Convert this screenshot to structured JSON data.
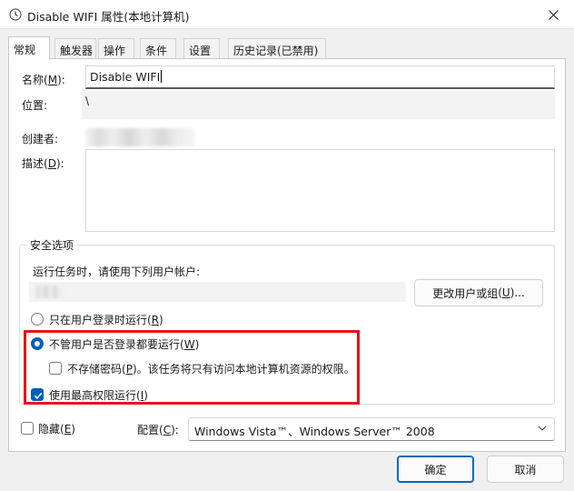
{
  "window": {
    "title": "Disable WIFI 属性(本地计算机)",
    "icon": "clock-icon"
  },
  "tabs": [
    "常规",
    "触发器",
    "操作",
    "条件",
    "设置",
    "历史记录(已禁用)"
  ],
  "general": {
    "name_label": "名称",
    "name_accel": "M",
    "name_value": "Disable WIFI",
    "location_label": "位置:",
    "location_value": "\\",
    "author_label": "创建者:",
    "description_label": "描述",
    "description_accel": "D"
  },
  "security": {
    "group_title": "安全选项",
    "run_as_text": "运行任务时，请使用下列用户帐户:",
    "change_user_label": "更改用户或组",
    "change_user_accel": "U",
    "option_logged_on": "只在用户登录时运行",
    "option_logged_on_accel": "R",
    "option_whether": "不管用户是否登录都要运行",
    "option_whether_accel": "W",
    "no_store_label": "不存储密码",
    "no_store_accel": "P",
    "no_store_suffix": "。该任务将只有访问本地计算机资源的权限。",
    "highest_label": "使用最高权限运行",
    "highest_accel": "I",
    "selected_option": "whether_logged_on",
    "no_store_checked": false,
    "highest_checked": true
  },
  "bottom": {
    "hidden_label": "隐藏",
    "hidden_accel": "E",
    "hidden_checked": false,
    "configure_label": "配置",
    "configure_accel": "C",
    "configure_value": "Windows Vista™、Windows Server™ 2008"
  },
  "buttons": {
    "ok": "确定",
    "cancel": "取消"
  },
  "colors": {
    "accent": "#005fb8",
    "highlight_box": "#e8101a"
  }
}
